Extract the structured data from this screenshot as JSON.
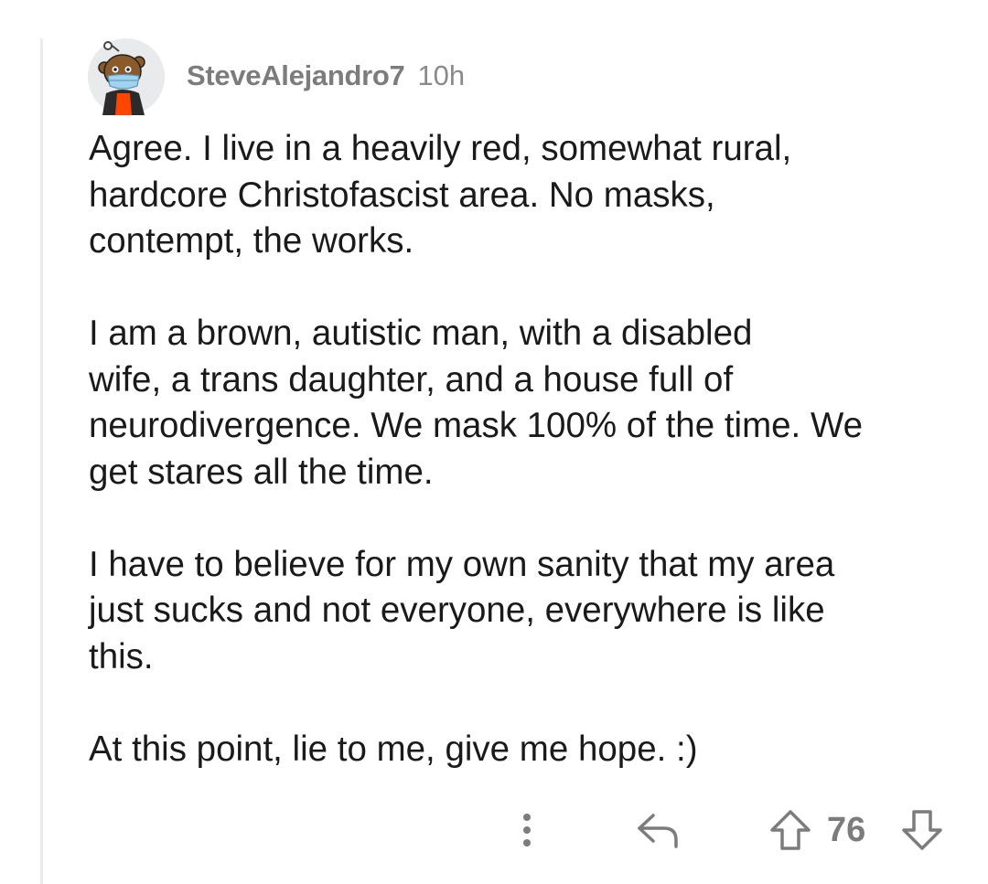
{
  "comment": {
    "username": "SteveAlejandro7",
    "age": "10h",
    "paragraphs": [
      "Agree. I live in a heavily red, somewhat rural,\nhardcore Christofascist area. No masks,\ncontempt, the works.",
      "I am a brown, autistic man, with a disabled\nwife, a trans daughter, and a house full of\nneurodivergence. We mask 100% of the time. We\nget stares all the time.",
      "I have to believe for my own sanity that my area\njust sucks and not everyone, everywhere is like\nthis.",
      "At this point, lie to me, give me hope. :)"
    ]
  },
  "actions": {
    "score": "76",
    "icons": [
      "more-options-icon",
      "reply-icon",
      "upvote-arrow-icon",
      "downvote-arrow-icon"
    ]
  },
  "colors": {
    "text": "#1a1a1b",
    "meta": "#7c7c7c",
    "thread_line": "#ececec",
    "avatar_bg": "#e9eaeb",
    "avatar_shirt": "#ff4500"
  }
}
